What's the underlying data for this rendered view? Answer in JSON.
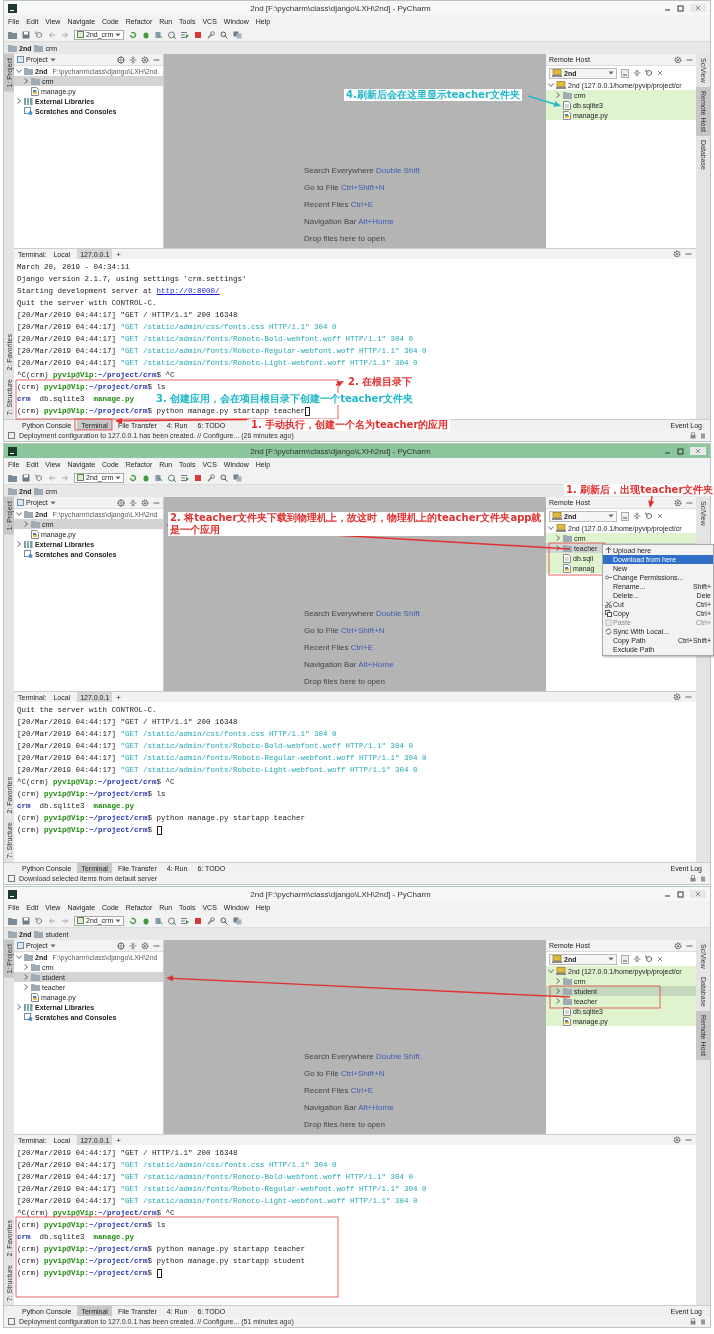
{
  "windows": [
    {
      "title": "2nd [F:\\pycharm\\class\\django\\LXH\\2nd] - PyCharm",
      "active": false,
      "menu": [
        "File",
        "Edit",
        "View",
        "Navigate",
        "Code",
        "Refactor",
        "Run",
        "Tools",
        "VCS",
        "Window",
        "Help"
      ],
      "run_config": "2nd_crm",
      "breadcrumbs": [
        "2nd",
        "crm"
      ],
      "left_tool_tabs": [
        {
          "label": "1: Project",
          "selected": true
        },
        {
          "label": "2: Favorites",
          "selected": false
        },
        {
          "label": "7: Structure",
          "selected": false
        }
      ],
      "right_tool_tabs": [
        {
          "label": "SciView",
          "selected": false
        },
        {
          "label": "Remote Host",
          "selected": true
        },
        {
          "label": "Database",
          "selected": false
        }
      ],
      "project": {
        "title": "Project",
        "tree": [
          {
            "label": "2nd",
            "path": "F:\\pycharm\\class\\django\\LXH\\2nd",
            "kind": "folder",
            "expanded": true,
            "selected": false,
            "children": [
              {
                "label": "crm",
                "kind": "folder",
                "expanded": false,
                "selected": true
              },
              {
                "label": "manage.py",
                "kind": "python-file",
                "selected": false
              }
            ]
          },
          {
            "label": "External Libraries",
            "kind": "library",
            "expanded": false,
            "selected": false
          },
          {
            "label": "Scratches and Consoles",
            "kind": "scratches",
            "selected": false
          }
        ]
      },
      "editor_hints": [
        {
          "label": "Search Everywhere",
          "shortcut": "Double Shift"
        },
        {
          "label": "Go to File",
          "shortcut": "Ctrl+Shift+N"
        },
        {
          "label": "Recent Files",
          "shortcut": "Ctrl+E"
        },
        {
          "label": "Navigation Bar",
          "shortcut": "Alt+Home"
        },
        {
          "label": "Drop files here to open"
        }
      ],
      "remote": {
        "title": "Remote Host",
        "server": "2nd",
        "tree": [
          {
            "label": "2nd (127.0.0.1/home/pyvip/project/cr",
            "kind": "server",
            "expanded": true,
            "selected": false,
            "modified": false,
            "children": [
              {
                "label": "crm",
                "kind": "folder",
                "expanded": false,
                "selected": false,
                "modified": true
              },
              {
                "label": "db.sqlite3",
                "kind": "file",
                "selected": false,
                "modified": true
              },
              {
                "label": "manage.py",
                "kind": "python-file",
                "selected": false,
                "modified": true
              }
            ]
          }
        ]
      },
      "terminal": {
        "title": "Terminal:",
        "tabs": [
          {
            "label": "Local",
            "selected": false
          },
          {
            "label": "127.0.0.1",
            "selected": true
          }
        ],
        "add": "+",
        "lines": [
          {
            "cursor": false,
            "segments": [
              {
                "kind": "plain",
                "text": "March 20, 2019 - 04:34:11"
              }
            ]
          },
          {
            "cursor": false,
            "segments": [
              {
                "kind": "plain",
                "text": "Django version 2.1.7, using settings 'crm.settings'"
              }
            ]
          },
          {
            "cursor": false,
            "segments": [
              {
                "kind": "plain",
                "text": "Starting development server at "
              },
              {
                "kind": "link",
                "text": "http://0:8000/"
              }
            ]
          },
          {
            "cursor": false,
            "segments": [
              {
                "kind": "plain",
                "text": "Quit the server with CONTROL-C."
              }
            ]
          },
          {
            "cursor": false,
            "segments": [
              {
                "kind": "plain",
                "text": "[20/Mar/2019 04:44:17] \"GET / HTTP/1.1\" 200 16348"
              }
            ]
          },
          {
            "cursor": false,
            "segments": [
              {
                "kind": "plain",
                "text": "[20/Mar/2019 04:44:17] "
              },
              {
                "kind": "cyan",
                "text": "\"GET /static/admin/css/fonts.css HTTP/1.1\" 304 0"
              }
            ]
          },
          {
            "cursor": false,
            "segments": [
              {
                "kind": "plain",
                "text": "[20/Mar/2019 04:44:17] "
              },
              {
                "kind": "cyan",
                "text": "\"GET /static/admin/fonts/Roboto-Bold-webfont.woff HTTP/1.1\" 304 0"
              }
            ]
          },
          {
            "cursor": false,
            "segments": [
              {
                "kind": "plain",
                "text": "[20/Mar/2019 04:44:17] "
              },
              {
                "kind": "cyan",
                "text": "\"GET /static/admin/fonts/Roboto-Regular-webfont.woff HTTP/1.1\" 304 0"
              }
            ]
          },
          {
            "cursor": false,
            "segments": [
              {
                "kind": "plain",
                "text": "[20/Mar/2019 04:44:17] "
              },
              {
                "kind": "cyan",
                "text": "\"GET /static/admin/fonts/Roboto-Light-webfont.woff HTTP/1.1\" 304 0"
              }
            ]
          },
          {
            "cursor": false,
            "segments": [
              {
                "kind": "plain",
                "text": "^C(crm) "
              },
              {
                "kind": "user",
                "text": "pyvip@Vip"
              },
              {
                "kind": "plain",
                "text": ":"
              },
              {
                "kind": "path",
                "text": "~/project/crm"
              },
              {
                "kind": "plain",
                "text": "$ ^C"
              }
            ]
          },
          {
            "cursor": false,
            "segments": [
              {
                "kind": "plain",
                "text": "(crm) "
              },
              {
                "kind": "user",
                "text": "pyvip@Vip"
              },
              {
                "kind": "plain",
                "text": ":"
              },
              {
                "kind": "path",
                "text": "~/project/crm"
              },
              {
                "kind": "plain",
                "text": "$ ls"
              }
            ]
          },
          {
            "cursor": false,
            "segments": [
              {
                "kind": "dir",
                "text": "crm"
              },
              {
                "kind": "plain",
                "text": "  db.sqlite3  "
              },
              {
                "kind": "exec",
                "text": "manage.py"
              }
            ]
          },
          {
            "cursor": true,
            "segments": [
              {
                "kind": "plain",
                "text": "(crm) "
              },
              {
                "kind": "user",
                "text": "pyvip@Vip"
              },
              {
                "kind": "plain",
                "text": ":"
              },
              {
                "kind": "path",
                "text": "~/project/crm"
              },
              {
                "kind": "plain",
                "text": "$ python manage.py startapp teacher"
              }
            ]
          }
        ]
      },
      "tool_buttons": [
        {
          "label": "Python Console",
          "selected": false
        },
        {
          "label": "Terminal",
          "selected": true
        },
        {
          "label": "File Transfer",
          "selected": false
        },
        {
          "label": "4: Run",
          "selected": false
        },
        {
          "label": "6: TODO",
          "selected": false
        }
      ],
      "event_log": "Event Log",
      "status": "Deployment configuration to 127.0.0.1 has been created. // Configure... (26 minutes ago)",
      "annotations": [
        {
          "text": "4.刷新后会在这里显示teacher文件夹",
          "color": "#22b8c8"
        },
        {
          "text": "2. 在根目录下",
          "color": "#e03030"
        },
        {
          "text": "3. 创建应用，会在项目根目录下创建一个teacher文件夹",
          "color": "#22b8c8"
        },
        {
          "text": "1. 手动执行，创建一个名为teacher的应用",
          "color": "#e03030"
        }
      ]
    },
    {
      "title": "2nd [F:\\pycharm\\class\\django\\LXH\\2nd] - PyCharm",
      "active": true,
      "menu": [
        "File",
        "Edit",
        "View",
        "Navigate",
        "Code",
        "Refactor",
        "Run",
        "Tools",
        "VCS",
        "Window",
        "Help"
      ],
      "run_config": "2nd_crm",
      "breadcrumbs": [
        "2nd",
        "crm"
      ],
      "left_tool_tabs": [
        {
          "label": "1: Project",
          "selected": true
        },
        {
          "label": "2: Favorites",
          "selected": false
        },
        {
          "label": "7: Structure",
          "selected": false
        }
      ],
      "right_tool_tabs": [
        {
          "label": "SciView",
          "selected": false
        }
      ],
      "project": {
        "title": "Project",
        "tree": [
          {
            "label": "2nd",
            "path": "F:\\pycharm\\class\\django\\LXH\\2nd",
            "kind": "folder",
            "expanded": true,
            "selected": false,
            "children": [
              {
                "label": "crm",
                "kind": "folder",
                "expanded": false,
                "selected": true
              },
              {
                "label": "manage.py",
                "kind": "python-file",
                "selected": false
              }
            ]
          },
          {
            "label": "External Libraries",
            "kind": "library",
            "expanded": false,
            "selected": false
          },
          {
            "label": "Scratches and Consoles",
            "kind": "scratches",
            "selected": false
          }
        ]
      },
      "editor_hints": [
        {
          "label": "Search Everywhere",
          "shortcut": "Double Shift"
        },
        {
          "label": "Go to File",
          "shortcut": "Ctrl+Shift+N"
        },
        {
          "label": "Recent Files",
          "shortcut": "Ctrl+E"
        },
        {
          "label": "Navigation Bar",
          "shortcut": "Alt+Home"
        },
        {
          "label": "Drop files here to open"
        }
      ],
      "remote": {
        "title": "Remote Host",
        "server": "2nd",
        "tree": [
          {
            "label": "2nd (127.0.0.1/home/pyvip/project/cr",
            "kind": "server",
            "expanded": true,
            "selected": false,
            "modified": false,
            "children": [
              {
                "label": "crm",
                "kind": "folder",
                "expanded": false,
                "selected": false,
                "modified": true
              },
              {
                "label": "teacher",
                "kind": "folder",
                "expanded": false,
                "selected": true,
                "modified": false
              },
              {
                "label": "db.sqli",
                "kind": "file",
                "selected": false,
                "modified": true
              },
              {
                "label": "manag",
                "kind": "python-file",
                "selected": false,
                "modified": true
              }
            ]
          }
        ]
      },
      "context_menu": [
        {
          "label": "Upload here",
          "selected": false,
          "disabled": false
        },
        {
          "label": "Download from here",
          "selected": true,
          "disabled": false
        },
        {
          "label": "New",
          "selected": false,
          "disabled": false
        },
        {
          "label": "Change Permissions...",
          "selected": false,
          "disabled": false
        },
        {
          "label": "Rename...",
          "shortcut": "Shift+",
          "selected": false,
          "disabled": false
        },
        {
          "label": "Delete...",
          "shortcut": "Dele",
          "selected": false,
          "disabled": false
        },
        {
          "label": "Cut",
          "shortcut": "Ctrl+",
          "selected": false,
          "disabled": false
        },
        {
          "label": "Copy",
          "shortcut": "Ctrl+",
          "selected": false,
          "disabled": false
        },
        {
          "label": "Paste",
          "shortcut": "Ctrl+",
          "selected": false,
          "disabled": true
        },
        {
          "label": "Sync With Local...",
          "selected": false,
          "disabled": false
        },
        {
          "label": "Copy Path",
          "shortcut": "Ctrl+Shift+",
          "selected": false,
          "disabled": false
        },
        {
          "label": "Exclude Path",
          "selected": false,
          "disabled": false
        }
      ],
      "terminal": {
        "title": "Terminal:",
        "tabs": [
          {
            "label": "Local",
            "selected": false
          },
          {
            "label": "127.0.0.1",
            "selected": true
          }
        ],
        "add": "+",
        "lines": [
          {
            "cursor": false,
            "segments": [
              {
                "kind": "plain",
                "text": "Quit the server with CONTROL-C."
              }
            ]
          },
          {
            "cursor": false,
            "segments": [
              {
                "kind": "plain",
                "text": "[20/Mar/2019 04:44:17] \"GET / HTTP/1.1\" 200 16348"
              }
            ]
          },
          {
            "cursor": false,
            "segments": [
              {
                "kind": "plain",
                "text": "[20/Mar/2019 04:44:17] "
              },
              {
                "kind": "cyan",
                "text": "\"GET /static/admin/css/fonts.css HTTP/1.1\" 304 0"
              }
            ]
          },
          {
            "cursor": false,
            "segments": [
              {
                "kind": "plain",
                "text": "[20/Mar/2019 04:44:17] "
              },
              {
                "kind": "cyan",
                "text": "\"GET /static/admin/fonts/Roboto-Bold-webfont.woff HTTP/1.1\" 304 0"
              }
            ]
          },
          {
            "cursor": false,
            "segments": [
              {
                "kind": "plain",
                "text": "[20/Mar/2019 04:44:17] "
              },
              {
                "kind": "cyan",
                "text": "\"GET /static/admin/fonts/Roboto-Regular-webfont.woff HTTP/1.1\" 304 0"
              }
            ]
          },
          {
            "cursor": false,
            "segments": [
              {
                "kind": "plain",
                "text": "[20/Mar/2019 04:44:17] "
              },
              {
                "kind": "cyan",
                "text": "\"GET /static/admin/fonts/Roboto-Light-webfont.woff HTTP/1.1\" 304 0"
              }
            ]
          },
          {
            "cursor": false,
            "segments": [
              {
                "kind": "plain",
                "text": "^C(crm) "
              },
              {
                "kind": "user",
                "text": "pyvip@Vip"
              },
              {
                "kind": "plain",
                "text": ":"
              },
              {
                "kind": "path",
                "text": "~/project/crm"
              },
              {
                "kind": "plain",
                "text": "$ ^C"
              }
            ]
          },
          {
            "cursor": false,
            "segments": [
              {
                "kind": "plain",
                "text": "(crm) "
              },
              {
                "kind": "user",
                "text": "pyvip@Vip"
              },
              {
                "kind": "plain",
                "text": ":"
              },
              {
                "kind": "path",
                "text": "~/project/crm"
              },
              {
                "kind": "plain",
                "text": "$ ls"
              }
            ]
          },
          {
            "cursor": false,
            "segments": [
              {
                "kind": "dir",
                "text": "crm"
              },
              {
                "kind": "plain",
                "text": "  db.sqlite3  "
              },
              {
                "kind": "exec",
                "text": "manage.py"
              }
            ]
          },
          {
            "cursor": false,
            "segments": [
              {
                "kind": "plain",
                "text": "(crm) "
              },
              {
                "kind": "user",
                "text": "pyvip@Vip"
              },
              {
                "kind": "plain",
                "text": ":"
              },
              {
                "kind": "path",
                "text": "~/project/crm"
              },
              {
                "kind": "plain",
                "text": "$ python manage.py startapp teacher"
              }
            ]
          },
          {
            "cursor": true,
            "segments": [
              {
                "kind": "plain",
                "text": "(crm) "
              },
              {
                "kind": "user",
                "text": "pyvip@Vip"
              },
              {
                "kind": "plain",
                "text": ":"
              },
              {
                "kind": "path",
                "text": "~/project/crm"
              },
              {
                "kind": "plain",
                "text": "$ "
              }
            ]
          }
        ]
      },
      "tool_buttons": [
        {
          "label": "Python Console",
          "selected": false
        },
        {
          "label": "Terminal",
          "selected": true
        },
        {
          "label": "File Transfer",
          "selected": false
        },
        {
          "label": "4: Run",
          "selected": false
        },
        {
          "label": "6: TODO",
          "selected": false
        }
      ],
      "event_log": "Event Log",
      "status": "Download selected items from default server",
      "annotations": [
        {
          "text": "1. 刷新后，出现teacher文件夹",
          "color": "#e03030"
        },
        {
          "text": "2. 将teacher文件夹下载到物理机上，故这时，物理机上的teacher文件夹app就是一个应用",
          "color": "#e03030"
        }
      ]
    },
    {
      "title": "2nd [F:\\pycharm\\class\\django\\LXH\\2nd] - PyCharm",
      "active": false,
      "menu": [
        "File",
        "Edit",
        "View",
        "Navigate",
        "Code",
        "Refactor",
        "Run",
        "Tools",
        "VCS",
        "Window",
        "Help"
      ],
      "run_config": "2nd_crm",
      "breadcrumbs": [
        "2nd",
        "student"
      ],
      "left_tool_tabs": [
        {
          "label": "1: Project",
          "selected": true
        },
        {
          "label": "2: Favorites",
          "selected": false
        },
        {
          "label": "7: Structure",
          "selected": false
        }
      ],
      "right_tool_tabs": [
        {
          "label": "SciView",
          "selected": false
        },
        {
          "label": "Database",
          "selected": false
        },
        {
          "label": "Remote Host",
          "selected": true
        }
      ],
      "project": {
        "title": "Project",
        "tree": [
          {
            "label": "2nd",
            "path": "F:\\pycharm\\class\\django\\LXH\\2nd",
            "kind": "folder",
            "expanded": true,
            "selected": false,
            "children": [
              {
                "label": "crm",
                "kind": "folder",
                "expanded": false,
                "selected": false
              },
              {
                "label": "student",
                "kind": "folder",
                "expanded": false,
                "selected": true
              },
              {
                "label": "teacher",
                "kind": "folder",
                "expanded": false,
                "selected": false
              },
              {
                "label": "manage.py",
                "kind": "python-file",
                "selected": false
              }
            ]
          },
          {
            "label": "External Libraries",
            "kind": "library",
            "expanded": false,
            "selected": false
          },
          {
            "label": "Scratches and Consoles",
            "kind": "scratches",
            "selected": false
          }
        ]
      },
      "editor_hints": [
        {
          "label": "Search Everywhere",
          "shortcut": "Double Shift"
        },
        {
          "label": "Go to File",
          "shortcut": "Ctrl+Shift+N"
        },
        {
          "label": "Recent Files",
          "shortcut": "Ctrl+E"
        },
        {
          "label": "Navigation Bar",
          "shortcut": "Alt+Home"
        },
        {
          "label": "Drop files here to open"
        }
      ],
      "remote": {
        "title": "Remote Host",
        "server": "2nd",
        "tree": [
          {
            "label": "2nd (127.0.0.1/home/pyvip/project/cr",
            "kind": "server",
            "expanded": true,
            "selected": false,
            "modified": true,
            "children": [
              {
                "label": "crm",
                "kind": "folder",
                "expanded": false,
                "selected": false,
                "modified": true
              },
              {
                "label": "student",
                "kind": "folder",
                "expanded": false,
                "selected": true,
                "modified": true
              },
              {
                "label": "teacher",
                "kind": "folder",
                "expanded": false,
                "selected": false,
                "modified": true
              },
              {
                "label": "db.sqlite3",
                "kind": "file",
                "selected": false,
                "modified": true
              },
              {
                "label": "manage.py",
                "kind": "python-file",
                "selected": false,
                "modified": true
              }
            ]
          }
        ]
      },
      "terminal": {
        "title": "Terminal:",
        "tabs": [
          {
            "label": "Local",
            "selected": false
          },
          {
            "label": "127.0.0.1",
            "selected": true
          }
        ],
        "add": "+",
        "lines": [
          {
            "cursor": false,
            "segments": [
              {
                "kind": "plain",
                "text": "[20/Mar/2019 04:44:17] \"GET / HTTP/1.1\" 200 16348"
              }
            ]
          },
          {
            "cursor": false,
            "segments": [
              {
                "kind": "plain",
                "text": "[20/Mar/2019 04:44:17] "
              },
              {
                "kind": "cyan",
                "text": "\"GET /static/admin/css/fonts.css HTTP/1.1\" 304 0"
              }
            ]
          },
          {
            "cursor": false,
            "segments": [
              {
                "kind": "plain",
                "text": "[20/Mar/2019 04:44:17] "
              },
              {
                "kind": "cyan",
                "text": "\"GET /static/admin/fonts/Roboto-Bold-webfont.woff HTTP/1.1\" 304 0"
              }
            ]
          },
          {
            "cursor": false,
            "segments": [
              {
                "kind": "plain",
                "text": "[20/Mar/2019 04:44:17] "
              },
              {
                "kind": "cyan",
                "text": "\"GET /static/admin/fonts/Roboto-Regular-webfont.woff HTTP/1.1\" 304 0"
              }
            ]
          },
          {
            "cursor": false,
            "segments": [
              {
                "kind": "plain",
                "text": "[20/Mar/2019 04:44:17] "
              },
              {
                "kind": "cyan",
                "text": "\"GET /static/admin/fonts/Roboto-Light-webfont.woff HTTP/1.1\" 304 0"
              }
            ]
          },
          {
            "cursor": false,
            "segments": [
              {
                "kind": "plain",
                "text": "^C(crm) "
              },
              {
                "kind": "user",
                "text": "pyvip@Vip"
              },
              {
                "kind": "plain",
                "text": ":"
              },
              {
                "kind": "path",
                "text": "~/project/crm"
              },
              {
                "kind": "plain",
                "text": "$ ^C"
              }
            ]
          },
          {
            "cursor": false,
            "segments": [
              {
                "kind": "plain",
                "text": "(crm) "
              },
              {
                "kind": "user",
                "text": "pyvip@Vip"
              },
              {
                "kind": "plain",
                "text": ":"
              },
              {
                "kind": "path",
                "text": "~/project/crm"
              },
              {
                "kind": "plain",
                "text": "$ ls"
              }
            ]
          },
          {
            "cursor": false,
            "segments": [
              {
                "kind": "dir",
                "text": "crm"
              },
              {
                "kind": "plain",
                "text": "  db.sqlite3  "
              },
              {
                "kind": "exec",
                "text": "manage.py"
              }
            ]
          },
          {
            "cursor": false,
            "segments": [
              {
                "kind": "plain",
                "text": "(crm) "
              },
              {
                "kind": "user",
                "text": "pyvip@Vip"
              },
              {
                "kind": "plain",
                "text": ":"
              },
              {
                "kind": "path",
                "text": "~/project/crm"
              },
              {
                "kind": "plain",
                "text": "$ python manage.py startapp teacher"
              }
            ]
          },
          {
            "cursor": false,
            "segments": [
              {
                "kind": "plain",
                "text": "(crm) "
              },
              {
                "kind": "user",
                "text": "pyvip@Vip"
              },
              {
                "kind": "plain",
                "text": ":"
              },
              {
                "kind": "path",
                "text": "~/project/crm"
              },
              {
                "kind": "plain",
                "text": "$ python manage.py startapp student"
              }
            ]
          },
          {
            "cursor": true,
            "segments": [
              {
                "kind": "plain",
                "text": "(crm) "
              },
              {
                "kind": "user",
                "text": "pyvip@Vip"
              },
              {
                "kind": "plain",
                "text": ":"
              },
              {
                "kind": "path",
                "text": "~/project/crm"
              },
              {
                "kind": "plain",
                "text": "$ "
              }
            ]
          }
        ]
      },
      "tool_buttons": [
        {
          "label": "Python Console",
          "selected": false
        },
        {
          "label": "Terminal",
          "selected": true
        },
        {
          "label": "File Transfer",
          "selected": false
        },
        {
          "label": "4: Run",
          "selected": false
        },
        {
          "label": "6: TODO",
          "selected": false
        }
      ],
      "event_log": "Event Log",
      "status": "Deployment configuration to 127.0.0.1 has been created. // Configure... (51 minutes ago)"
    }
  ]
}
